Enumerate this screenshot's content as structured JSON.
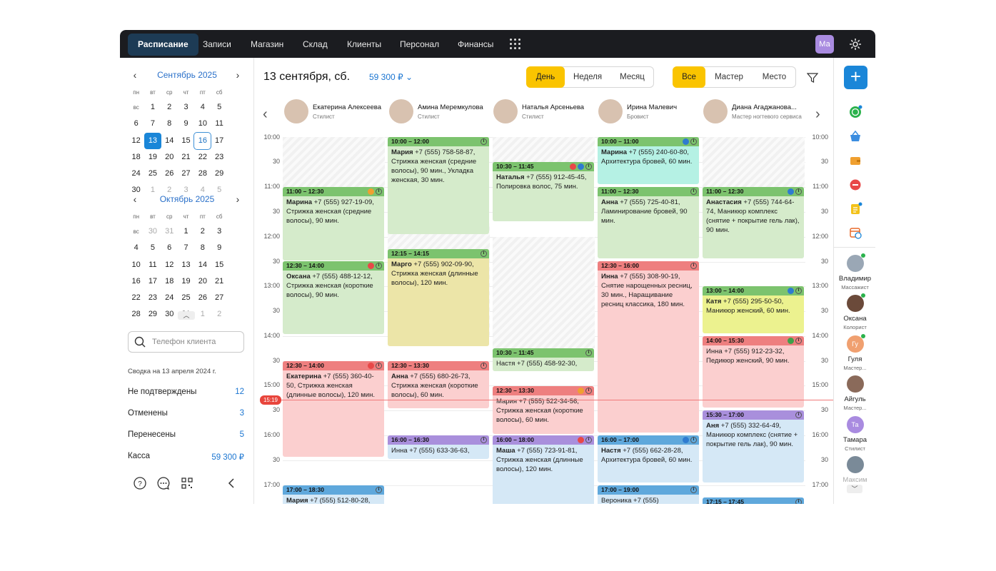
{
  "nav": {
    "items": [
      "Расписание",
      "Записи",
      "Магазин",
      "Склад",
      "Клиенты",
      "Персонал",
      "Финансы"
    ],
    "active": "Расписание",
    "avatar": "Ма"
  },
  "calendar": {
    "weekdays": [
      "пн",
      "вт",
      "ср",
      "чт",
      "пт",
      "сб",
      "вс"
    ],
    "sept": {
      "title": "Сентябрь 2025",
      "days": [
        "1",
        "2",
        "3",
        "4",
        "5",
        "6",
        "7",
        "8",
        "9",
        "10",
        "11",
        "12",
        "13",
        "14",
        "15",
        "16",
        "17",
        "18",
        "19",
        "20",
        "21",
        "22",
        "23",
        "24",
        "25",
        "26",
        "27",
        "28",
        "29",
        "30",
        "1",
        "2",
        "3",
        "4",
        "5"
      ],
      "selected": "13",
      "today": "16"
    },
    "oct": {
      "title": "Октябрь 2025",
      "days": [
        "30",
        "31",
        "1",
        "2",
        "3",
        "4",
        "5",
        "6",
        "7",
        "8",
        "9",
        "10",
        "11",
        "12",
        "13",
        "14",
        "15",
        "16",
        "17",
        "18",
        "19",
        "20",
        "21",
        "22",
        "23",
        "24",
        "25",
        "26",
        "27",
        "28",
        "29",
        "30",
        "31",
        "1",
        "2"
      ]
    }
  },
  "search": {
    "placeholder": "Телефон клиента"
  },
  "summary": {
    "title": "Сводка на 13 апреля 2024 г.",
    "rows": [
      {
        "label": "Не подтверждены",
        "value": "12"
      },
      {
        "label": "Отменены",
        "value": "3"
      },
      {
        "label": "Перенесены",
        "value": "5"
      },
      {
        "label": "Касса",
        "value": "59 300 ₽"
      }
    ]
  },
  "header": {
    "date": "13 сентября, сб.",
    "amount": "59 300 ₽",
    "view_tabs": [
      "День",
      "Неделя",
      "Месяц"
    ],
    "view_active": "День",
    "group_tabs": [
      "Все",
      "Мастер",
      "Место"
    ],
    "group_active": "Все"
  },
  "staff": [
    {
      "name": "Екатерина Алексеева",
      "role": "Стилист"
    },
    {
      "name": "Амина Меремкулова",
      "role": "Стилист"
    },
    {
      "name": "Наталья Арсеньева",
      "role": "Стилист"
    },
    {
      "name": "Ирина Малевич",
      "role": "Бровист"
    },
    {
      "name": "Диана Агаджанова...",
      "role": "Мастер ногтевого сервиса"
    }
  ],
  "times": [
    "10:00",
    "30",
    "11:00",
    "30",
    "12:00",
    "30",
    "13:00",
    "30",
    "14:00",
    "30",
    "15:00",
    "30",
    "16:00",
    "30",
    "17:00"
  ],
  "now": "15:19",
  "colors": {
    "green": "#7cc36e",
    "green_bg": "#d5ebcb",
    "red": "#ee7f7f",
    "red_bg": "#fbcfcf",
    "purple": "#a98fdc",
    "purple_bg": "#d8e8f5",
    "blue": "#5fa8dc",
    "blue_bg": "#d5e8f6",
    "yellow_bg": "#ece5a8",
    "lime_bg": "#ecf28f",
    "mint_bg": "#b5f1e4"
  },
  "events": [
    {
      "time": "11:00 – 12:30",
      "name": "Марина",
      "text": " +7 (555) 927-19-09, Стрижка женская (средние волосы), 90 мин."
    },
    {
      "time": "12:30 – 14:00",
      "name": "Оксана",
      "text": " +7 (555) 488-12-12, Стрижка женская (короткие волосы), 90 мин."
    },
    {
      "time": "12:30 – 14:00",
      "name": "Екатерина",
      "text": " +7 (555) 360-40-50, Стрижка женская (длинные волосы), 120 мин."
    },
    {
      "time": "17:00 – 18:30",
      "name": "Мария",
      "text": " +7 (555) 512-80-28,"
    },
    {
      "time": "10:00 – 12:00",
      "name": "Мария",
      "text": " +7 (555) 758-58-87, Стрижка женская (средние волосы), 90 мин., Укладка женская, 30 мин."
    },
    {
      "time": "12:15 – 14:15",
      "name": "Марго",
      "text": " +7 (555) 902-09-90, Стрижка женская (длинные волосы), 120 мин."
    },
    {
      "time": "12:30 – 13:30",
      "name": "Анна",
      "text": " +7 (555) 680-26-73, Стрижка женская (короткие волосы), 60 мин."
    },
    {
      "time": "16:00 – 16:30",
      "name": "",
      "text": "Инна +7 (555) 633-36-63,"
    },
    {
      "time": "10:30 – 11:45",
      "name": "Наталья",
      "text": " +7 (555) 912-45-45, Полировка волос, 75 мин."
    },
    {
      "time": "10:30 – 11:45",
      "name": "",
      "text": "Настя +7 (555) 458-92-30,"
    },
    {
      "time": "12:30 – 13:30",
      "name": "",
      "text": "Мария +7 (555) 522-34-56, Стрижка женская (короткие волосы), 60 мин."
    },
    {
      "time": "16:00 – 18:00",
      "name": "Маша",
      "text": " +7 (555) 723-91-81, Стрижка женская (длинные волосы), 120 мин."
    },
    {
      "time": "10:00 – 11:00",
      "name": "Марина",
      "text": " +7 (555) 240-60-80, Архитектура бровей, 60 мин."
    },
    {
      "time": "11:00 – 12:30",
      "name": "Анна",
      "text": " +7 (555) 725-40-81, Ламинирование бровей, 90 мин."
    },
    {
      "time": "12:30 – 16:00",
      "name": "Инна",
      "text": " +7 (555) 308-90-19, Снятие нарощенных ресниц, 30 мин., Наращивание ресниц классика, 180 мин."
    },
    {
      "time": "16:00 – 17:00",
      "name": "Настя",
      "text": " +7 (555) 662-28-28, Архитектура бровей, 60 мин."
    },
    {
      "time": "17:00 – 19:00",
      "name": "",
      "text": "Вероника +7 (555)"
    },
    {
      "time": "11:00 – 12:30",
      "name": "Анастасия",
      "text": " +7 (555) 744-64-74, Маникюр комплекс (снятие + покрытие гель лак), 90 мин."
    },
    {
      "time": "13:00 – 14:00",
      "name": "Катя",
      "text": " +7 (555) 295-50-50, Маникюр женский, 60 мин."
    },
    {
      "time": "14:00 – 15:30",
      "name": "",
      "text": "Инна +7 (555) 912-23-32, Педикюр женский, 90 мин."
    },
    {
      "time": "15:30 – 17:00",
      "name": "Аня",
      "text": " +7 (555) 332-64-49, Маникюр комплекс (снятие + покрытие гель лак), 90 мин."
    },
    {
      "time": "17:15 – 17:45",
      "name": "",
      "text": ""
    }
  ],
  "masters": [
    {
      "name": "Владимир",
      "role": "Массажист",
      "initials": ""
    },
    {
      "name": "Оксана",
      "role": "Колорист",
      "initials": ""
    },
    {
      "name": "Гуля",
      "role": "Мастер...",
      "initials": "Гу"
    },
    {
      "name": "Айгуль",
      "role": "Мастер...",
      "initials": ""
    },
    {
      "name": "Тамара",
      "role": "Стилист",
      "initials": "Та"
    },
    {
      "name": "Максим",
      "role": "",
      "initials": ""
    }
  ]
}
